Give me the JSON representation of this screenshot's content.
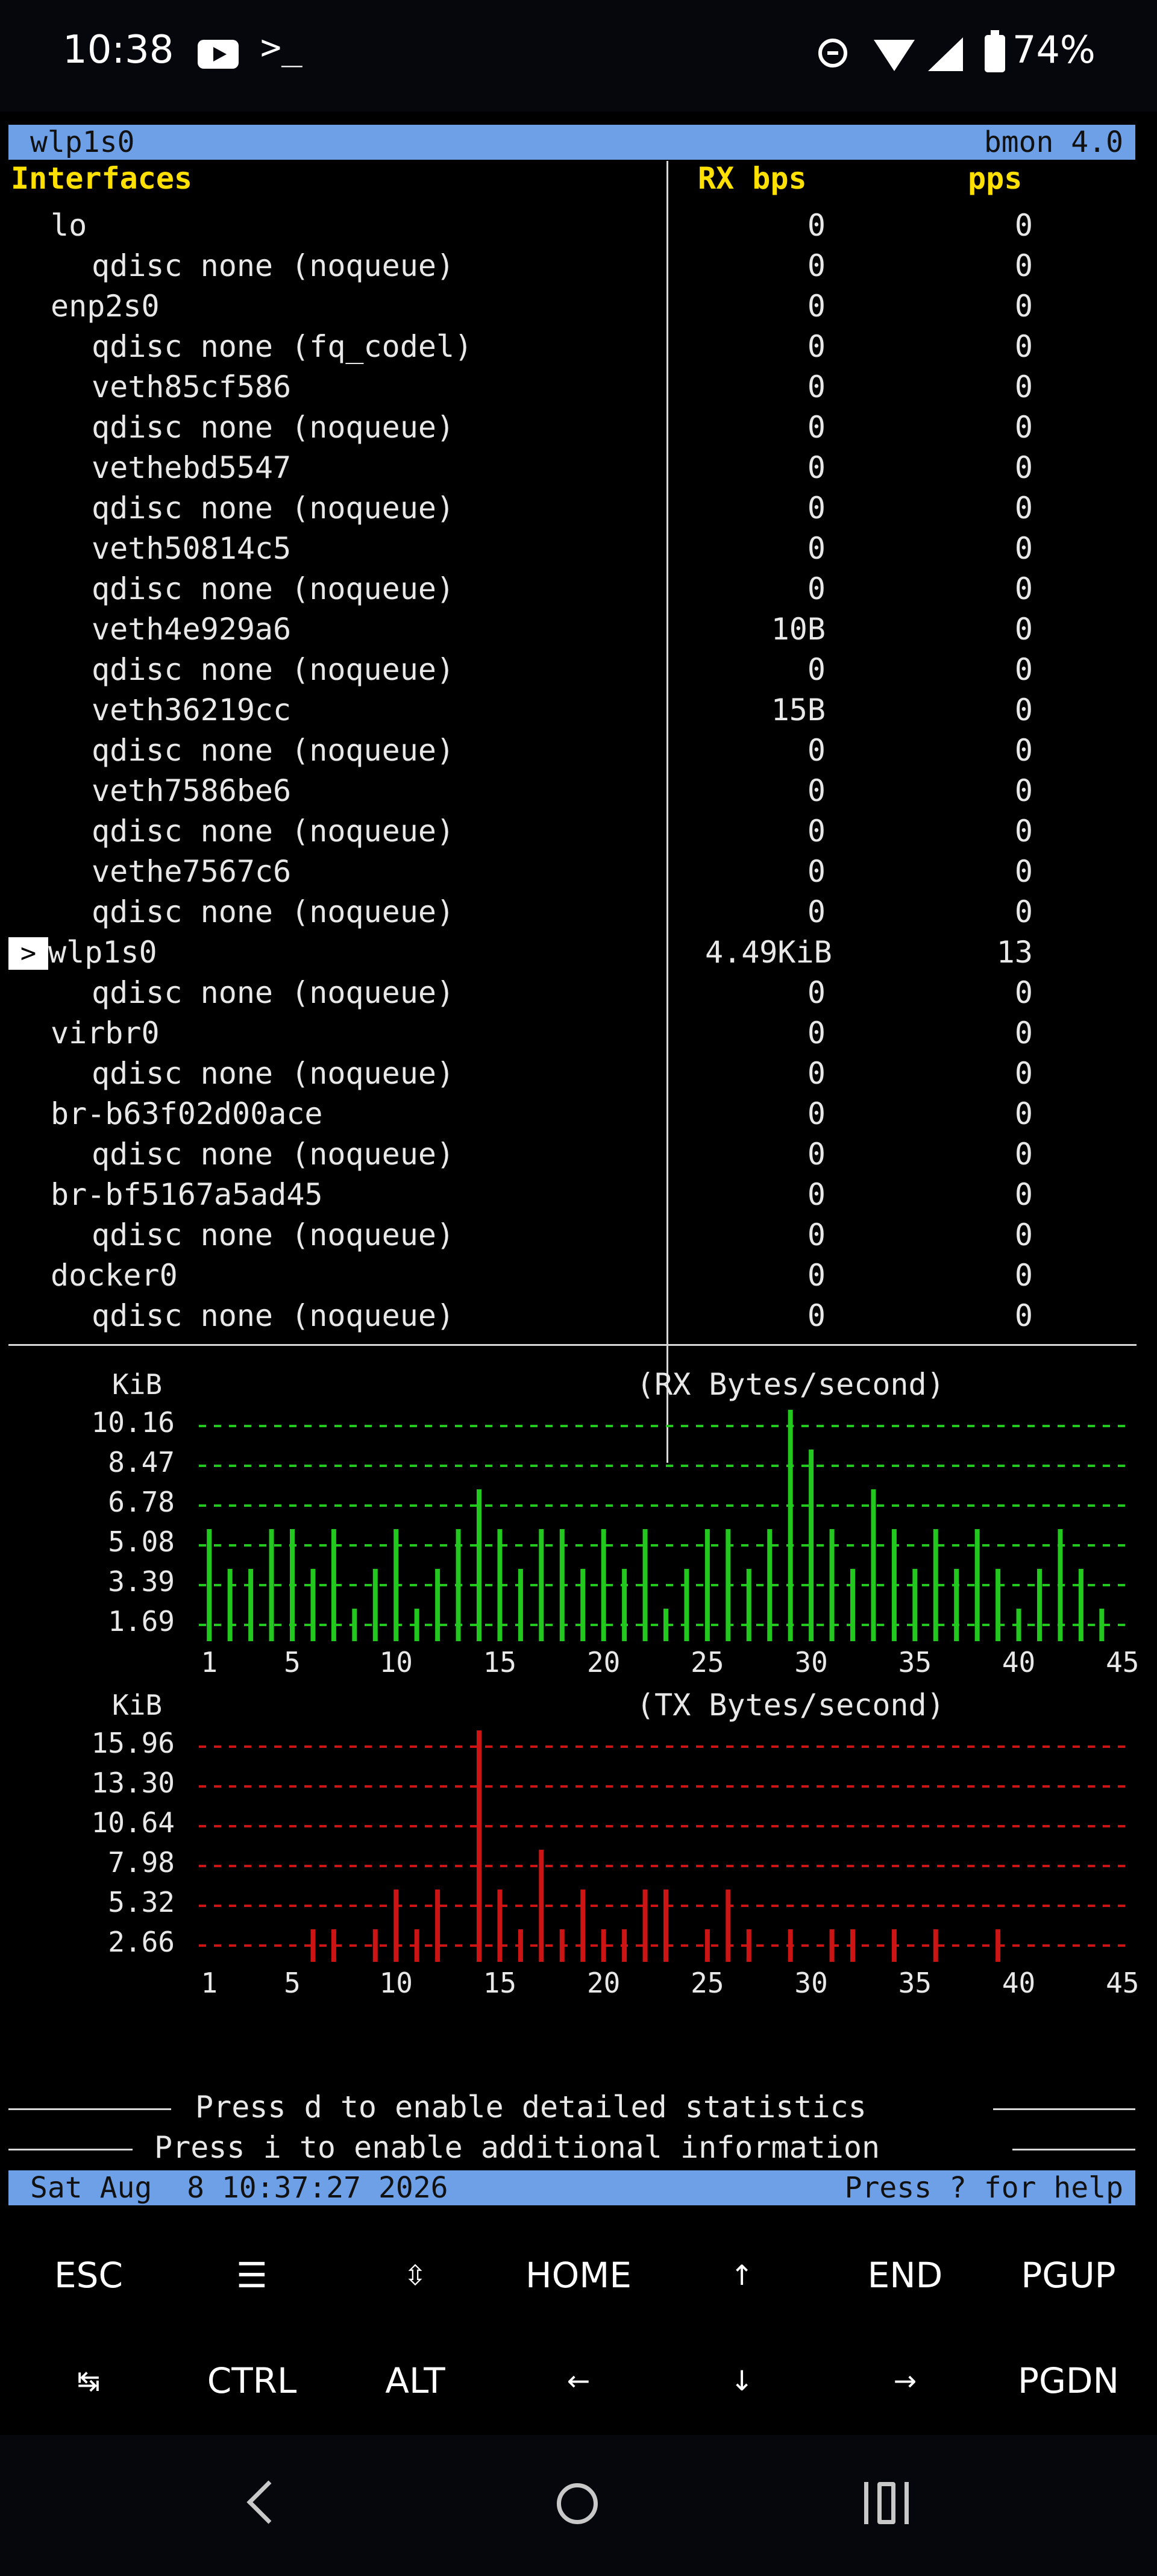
{
  "status_bar": {
    "time": "10:38",
    "terminal_glyph": ">_",
    "battery_percent": "74%",
    "icons": [
      "youtube-icon",
      "terminal-icon",
      "do-not-disturb-icon",
      "wifi-icon",
      "cell-signal-icon",
      "battery-icon"
    ]
  },
  "bmon": {
    "title_left": "wlp1s0",
    "title_right": "bmon 4.0",
    "columns": {
      "interfaces": "Interfaces",
      "rx": "RX bps",
      "pps": "pps"
    },
    "selected_marker": ">",
    "rows": [
      {
        "name": "lo",
        "indent": 1,
        "rx": "0",
        "pps": "0"
      },
      {
        "name": "qdisc none (noqueue)",
        "indent": 2,
        "rx": "0",
        "pps": "0"
      },
      {
        "name": "enp2s0",
        "indent": 1,
        "rx": "0",
        "pps": "0"
      },
      {
        "name": "qdisc none (fq_codel)",
        "indent": 2,
        "rx": "0",
        "pps": "0"
      },
      {
        "name": "veth85cf586",
        "indent": 2,
        "rx": "0",
        "pps": "0"
      },
      {
        "name": "qdisc none (noqueue)",
        "indent": 2,
        "rx": "0",
        "pps": "0"
      },
      {
        "name": "vethebd5547",
        "indent": 2,
        "rx": "0",
        "pps": "0"
      },
      {
        "name": "qdisc none (noqueue)",
        "indent": 2,
        "rx": "0",
        "pps": "0"
      },
      {
        "name": "veth50814c5",
        "indent": 2,
        "rx": "0",
        "pps": "0"
      },
      {
        "name": "qdisc none (noqueue)",
        "indent": 2,
        "rx": "0",
        "pps": "0"
      },
      {
        "name": "veth4e929a6",
        "indent": 2,
        "rx": "10B",
        "pps": "0"
      },
      {
        "name": "qdisc none (noqueue)",
        "indent": 2,
        "rx": "0",
        "pps": "0"
      },
      {
        "name": "veth36219cc",
        "indent": 2,
        "rx": "15B",
        "pps": "0"
      },
      {
        "name": "qdisc none (noqueue)",
        "indent": 2,
        "rx": "0",
        "pps": "0"
      },
      {
        "name": "veth7586be6",
        "indent": 2,
        "rx": "0",
        "pps": "0"
      },
      {
        "name": "qdisc none (noqueue)",
        "indent": 2,
        "rx": "0",
        "pps": "0"
      },
      {
        "name": "vethe7567c6",
        "indent": 2,
        "rx": "0",
        "pps": "0"
      },
      {
        "name": "qdisc none (noqueue)",
        "indent": 2,
        "rx": "0",
        "pps": "0"
      },
      {
        "name": "wlp1s0",
        "indent": 0,
        "rx": "4.49KiB",
        "pps": "13",
        "selected": true
      },
      {
        "name": "qdisc none (noqueue)",
        "indent": 2,
        "rx": "0",
        "pps": "0"
      },
      {
        "name": "virbr0",
        "indent": 1,
        "rx": "0",
        "pps": "0"
      },
      {
        "name": "qdisc none (noqueue)",
        "indent": 2,
        "rx": "0",
        "pps": "0"
      },
      {
        "name": "br-b63f02d00ace",
        "indent": 1,
        "rx": "0",
        "pps": "0"
      },
      {
        "name": "qdisc none (noqueue)",
        "indent": 2,
        "rx": "0",
        "pps": "0"
      },
      {
        "name": "br-bf5167a5ad45",
        "indent": 1,
        "rx": "0",
        "pps": "0"
      },
      {
        "name": "qdisc none (noqueue)",
        "indent": 2,
        "rx": "0",
        "pps": "0"
      },
      {
        "name": "docker0",
        "indent": 1,
        "rx": "0",
        "pps": "0"
      },
      {
        "name": "qdisc none (noqueue)",
        "indent": 2,
        "rx": "0",
        "pps": "0"
      }
    ],
    "hint_detailed": "Press d to enable detailed statistics",
    "hint_additional": "Press i to enable additional information",
    "footer_datetime": "Sat Aug  8 10:37:27 2026",
    "footer_help": "Press ? for help"
  },
  "chart_data": [
    {
      "type": "bar",
      "title": "(RX Bytes/second)",
      "ylabel": "KiB",
      "color": "#22c81e",
      "y_ticks": [
        "10.16",
        "8.47",
        "6.78",
        "5.08",
        "3.39",
        "1.69"
      ],
      "x_ticks": [
        "1",
        "5",
        "10",
        "15",
        "20",
        "25",
        "30",
        "35",
        "40",
        "45"
      ],
      "ylim": [
        0,
        10.16
      ],
      "x": [
        1,
        2,
        3,
        4,
        5,
        6,
        7,
        8,
        9,
        10,
        11,
        12,
        13,
        14,
        15,
        16,
        17,
        18,
        19,
        20,
        21,
        22,
        23,
        24,
        25,
        26,
        27,
        28,
        29,
        30,
        31,
        32,
        33,
        34,
        35,
        36,
        37,
        38,
        39,
        40,
        41,
        42,
        43,
        44,
        45
      ],
      "values": [
        5.08,
        3.39,
        3.39,
        5.08,
        5.08,
        3.39,
        5.08,
        1.69,
        3.39,
        5.08,
        1.69,
        3.39,
        5.08,
        6.78,
        5.08,
        3.39,
        5.08,
        5.08,
        3.39,
        5.08,
        3.39,
        5.08,
        1.69,
        3.39,
        5.08,
        5.08,
        3.39,
        5.08,
        10.16,
        8.47,
        5.08,
        3.39,
        6.78,
        5.08,
        3.39,
        5.08,
        3.39,
        5.08,
        3.39,
        1.69,
        3.39,
        5.08,
        3.39,
        1.69,
        0
      ]
    },
    {
      "type": "bar",
      "title": "(TX Bytes/second)",
      "ylabel": "KiB",
      "color": "#cc1414",
      "y_ticks": [
        "15.96",
        "13.30",
        "10.64",
        "7.98",
        "5.32",
        "2.66"
      ],
      "x_ticks": [
        "1",
        "5",
        "10",
        "15",
        "20",
        "25",
        "30",
        "35",
        "40",
        "45"
      ],
      "ylim": [
        0,
        15.96
      ],
      "x": [
        1,
        2,
        3,
        4,
        5,
        6,
        7,
        8,
        9,
        10,
        11,
        12,
        13,
        14,
        15,
        16,
        17,
        18,
        19,
        20,
        21,
        22,
        23,
        24,
        25,
        26,
        27,
        28,
        29,
        30,
        31,
        32,
        33,
        34,
        35,
        36,
        37,
        38,
        39,
        40,
        41,
        42,
        43,
        44,
        45
      ],
      "values": [
        0,
        0,
        0,
        0,
        0,
        2.66,
        2.66,
        0,
        2.66,
        5.32,
        2.66,
        5.32,
        0,
        15.96,
        5.32,
        2.66,
        7.98,
        2.66,
        5.32,
        2.66,
        2.66,
        5.32,
        5.32,
        0,
        2.66,
        5.32,
        2.66,
        0,
        2.66,
        0,
        2.66,
        2.66,
        0,
        2.66,
        0,
        2.66,
        0,
        0,
        2.66,
        0,
        0,
        0,
        0,
        0,
        0
      ]
    }
  ],
  "extra_keys": {
    "row1": [
      "ESC",
      "☰",
      "⇳",
      "HOME",
      "↑",
      "END",
      "PGUP"
    ],
    "row2": [
      "↹",
      "CTRL",
      "ALT",
      "←",
      "↓",
      "→",
      "PGDN"
    ]
  },
  "nav_icons": [
    "back-icon",
    "home-icon",
    "recents-icon"
  ]
}
